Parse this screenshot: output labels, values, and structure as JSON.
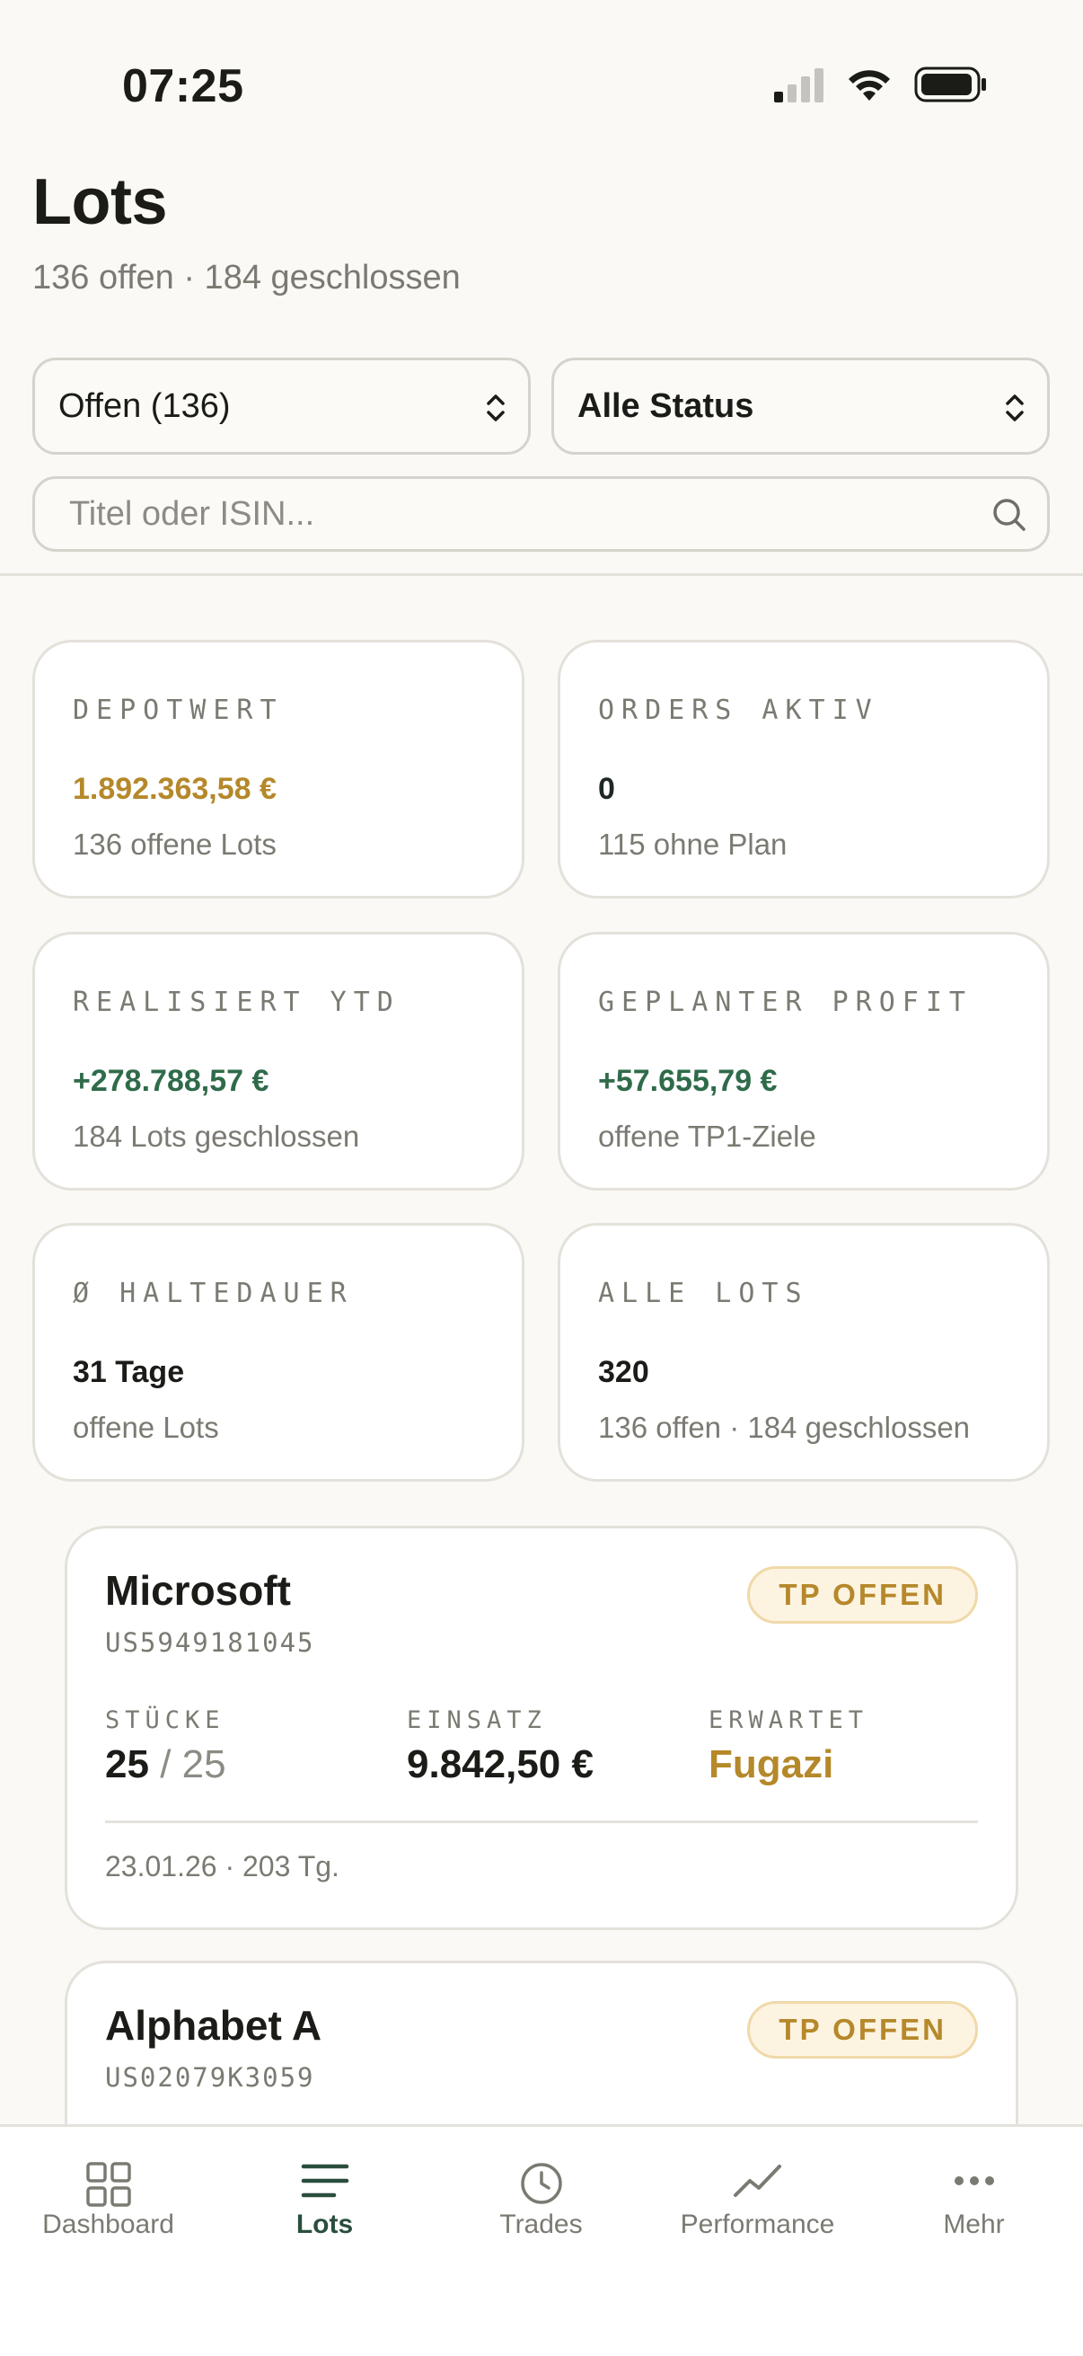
{
  "status_bar": {
    "time": "07:25"
  },
  "header": {
    "title": "Lots",
    "subtitle": "136 offen · 184 geschlossen"
  },
  "filters": {
    "scope_select": "Offen (136)",
    "status_select": "Alle Status",
    "search_placeholder": "Titel oder ISIN..."
  },
  "stats": [
    {
      "label": "DEPOTWERT",
      "value": "1.892.363,58 €",
      "sub": "136 offene Lots",
      "value_color": "gold",
      "sub_color": "muted"
    },
    {
      "label": "ORDERS AKTIV",
      "value": "0",
      "sub": "115 ohne Plan",
      "value_color": "dark",
      "sub_color": "gold"
    },
    {
      "label": "REALISIERT YTD",
      "value": "+278.788,57 €",
      "sub": "184 Lots geschlossen",
      "value_color": "green",
      "sub_color": "muted"
    },
    {
      "label": "GEPLANTER PROFIT",
      "value": "+57.655,79 €",
      "sub": "offene TP1-Ziele",
      "value_color": "green",
      "sub_color": "muted"
    },
    {
      "label": "Ø HALTEDAUER",
      "value": "31 Tage",
      "sub": "offene Lots",
      "value_color": "black",
      "sub_color": "muted"
    },
    {
      "label": "ALLE LOTS",
      "value": "320",
      "sub": "136 offen · 184 geschlossen",
      "value_color": "black",
      "sub_color": "muted"
    }
  ],
  "lots": [
    {
      "name": "Microsoft",
      "isin": "US5949181045",
      "badge": "TP OFFEN",
      "shares_label": "STÜCKE",
      "shares_value": "25",
      "shares_sep": "/",
      "shares_total": "25",
      "stake_label": "EINSATZ",
      "stake_value": "9.842,50 €",
      "expected_label": "ERWARTET",
      "expected_value": "Fugazi",
      "meta": "23.01.26 · 203 Tg."
    },
    {
      "name": "Alphabet A",
      "isin": "US02079K3059",
      "badge": "TP OFFEN"
    }
  ],
  "nav": [
    {
      "label": "Dashboard",
      "icon": "grid-icon"
    },
    {
      "label": "Lots",
      "icon": "list-icon",
      "active": true
    },
    {
      "label": "Trades",
      "icon": "clock-icon"
    },
    {
      "label": "Performance",
      "icon": "trend-icon"
    },
    {
      "label": "Mehr",
      "icon": "more-icon"
    }
  ],
  "colors": {
    "accent_green": "#2a4e3e",
    "gold": "#b5882a",
    "positive": "#2f6b4a",
    "background": "#faf9f6"
  }
}
